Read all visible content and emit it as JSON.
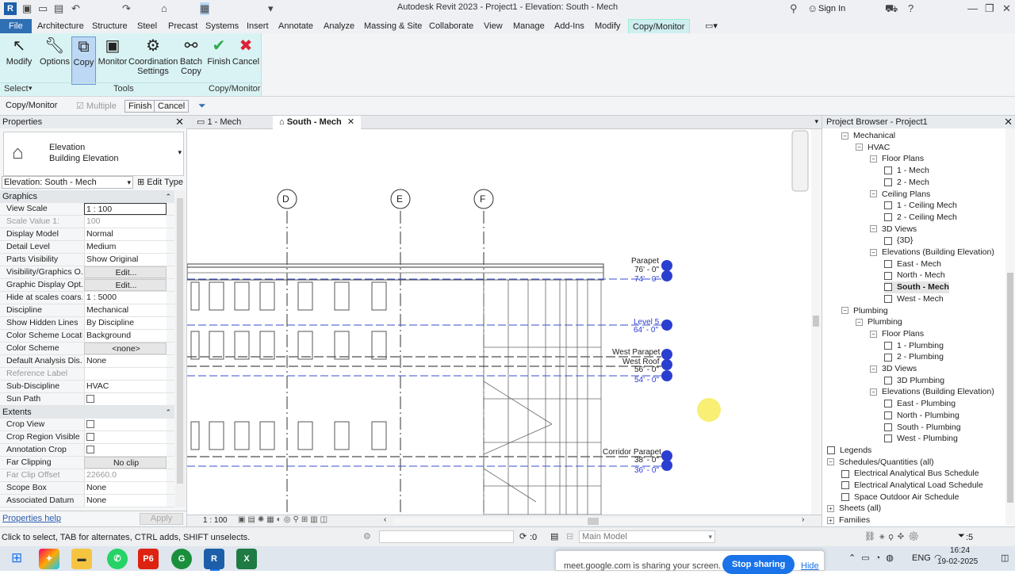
{
  "window": {
    "title": "Autodesk Revit 2023 - Project1 - Elevation: South - Mech",
    "sign_in": "Sign In"
  },
  "menu": [
    "File",
    "Architecture",
    "Structure",
    "Steel",
    "Precast",
    "Systems",
    "Insert",
    "Annotate",
    "Analyze",
    "Massing & Site",
    "Collaborate",
    "View",
    "Manage",
    "Add-Ins",
    "Modify",
    "Copy/Monitor"
  ],
  "ribbon": {
    "buttons": [
      {
        "label": "Modify",
        "icon": "cursor-icon"
      },
      {
        "label": "Options",
        "icon": "wrench-icon"
      },
      {
        "label": "Copy",
        "icon": "copy-icon"
      },
      {
        "label": "Monitor",
        "icon": "monitor-icon"
      },
      {
        "label": "Coordination Settings",
        "icon": "settings-icon"
      },
      {
        "label": "Batch Copy",
        "icon": "batch-icon"
      },
      {
        "label": "Finish",
        "icon": "check-icon"
      },
      {
        "label": "Cancel",
        "icon": "x-icon"
      }
    ],
    "panel_select": "Select",
    "panel_tools": "Tools",
    "panel_copymon": "Copy/Monitor"
  },
  "optionsbar": {
    "context": "Copy/Monitor",
    "multiple": "Multiple",
    "finish": "Finish",
    "cancel": "Cancel"
  },
  "properties": {
    "title": "Properties",
    "type_name": "Elevation",
    "type_sub": "Building Elevation",
    "selector": "Elevation: South - Mech",
    "edit_type": "Edit Type",
    "graphics": "Graphics",
    "rows": [
      {
        "k": "View Scale",
        "v": "1 : 100"
      },
      {
        "k": "Scale Value    1:",
        "v": "100",
        "dim": true
      },
      {
        "k": "Display Model",
        "v": "Normal"
      },
      {
        "k": "Detail Level",
        "v": "Medium"
      },
      {
        "k": "Parts Visibility",
        "v": "Show Original"
      },
      {
        "k": "Visibility/Graphics O...",
        "v": "Edit...",
        "btn": true
      },
      {
        "k": "Graphic Display Opt...",
        "v": "Edit...",
        "btn": true
      },
      {
        "k": "Hide at scales coars...",
        "v": "1 : 5000"
      },
      {
        "k": "Discipline",
        "v": "Mechanical"
      },
      {
        "k": "Show Hidden Lines",
        "v": "By Discipline"
      },
      {
        "k": "Color Scheme Locati...",
        "v": "Background"
      },
      {
        "k": "Color Scheme",
        "v": "<none>",
        "btn": true
      },
      {
        "k": "Default Analysis Dis...",
        "v": "None"
      },
      {
        "k": "Reference Label",
        "v": "",
        "dim": true
      },
      {
        "k": "Sub-Discipline",
        "v": "HVAC"
      },
      {
        "k": "Sun Path",
        "v": "",
        "cb": true
      }
    ],
    "extents": "Extents",
    "rows2": [
      {
        "k": "Crop View",
        "v": "",
        "cb": true
      },
      {
        "k": "Crop Region Visible",
        "v": "",
        "cb": true
      },
      {
        "k": "Annotation Crop",
        "v": "",
        "cb": true
      },
      {
        "k": "Far Clipping",
        "v": "No clip",
        "btn": true
      },
      {
        "k": "Far Clip Offset",
        "v": "22660.0",
        "dim": true
      },
      {
        "k": "Scope Box",
        "v": "None"
      },
      {
        "k": "Associated Datum",
        "v": "None"
      }
    ],
    "help": "Properties help",
    "apply": "Apply"
  },
  "tabs": [
    {
      "label": "1 - Mech"
    },
    {
      "label": "South - Mech"
    }
  ],
  "drawing": {
    "grids": [
      "D",
      "E",
      "F"
    ],
    "levels": [
      {
        "name": "Parapet",
        "elev": "76' - 0\""
      },
      {
        "name": "",
        "elev": "74' - 0\""
      },
      {
        "name": "Level 5",
        "elev": "64' - 0\""
      },
      {
        "name": "West Parapet",
        "elev": ""
      },
      {
        "name": "West Roof",
        "elev": "56' - 0\""
      },
      {
        "name": "",
        "elev": "54' - 0\""
      },
      {
        "name": "Corridor Parapet",
        "elev": "38' - 0\""
      },
      {
        "name": "",
        "elev": "36' - 0\""
      }
    ]
  },
  "viewbar": {
    "scale": "1 : 100"
  },
  "browser": {
    "title": "Project Browser - Project1"
  },
  "tree": [
    {
      "t": "Mechanical",
      "d": 1,
      "g": "−"
    },
    {
      "t": "HVAC",
      "d": 2,
      "g": "−"
    },
    {
      "t": "Floor Plans",
      "d": 3,
      "g": "−"
    },
    {
      "t": "1 - Mech",
      "d": 4,
      "v": true
    },
    {
      "t": "2 - Mech",
      "d": 4,
      "v": true
    },
    {
      "t": "Ceiling Plans",
      "d": 3,
      "g": "−"
    },
    {
      "t": "1 - Ceiling Mech",
      "d": 4,
      "v": true
    },
    {
      "t": "2 - Ceiling Mech",
      "d": 4,
      "v": true
    },
    {
      "t": "3D Views",
      "d": 3,
      "g": "−"
    },
    {
      "t": "{3D}",
      "d": 4,
      "v": true
    },
    {
      "t": "Elevations (Building Elevation)",
      "d": 3,
      "g": "−"
    },
    {
      "t": "East - Mech",
      "d": 4,
      "v": true
    },
    {
      "t": "North - Mech",
      "d": 4,
      "v": true
    },
    {
      "t": "South - Mech",
      "d": 4,
      "v": true,
      "sel": true
    },
    {
      "t": "West - Mech",
      "d": 4,
      "v": true
    },
    {
      "t": "Plumbing",
      "d": 1,
      "g": "−"
    },
    {
      "t": "Plumbing",
      "d": 2,
      "g": "−"
    },
    {
      "t": "Floor Plans",
      "d": 3,
      "g": "−"
    },
    {
      "t": "1 - Plumbing",
      "d": 4,
      "v": true
    },
    {
      "t": "2 - Plumbing",
      "d": 4,
      "v": true
    },
    {
      "t": "3D Views",
      "d": 3,
      "g": "−"
    },
    {
      "t": "3D Plumbing",
      "d": 4,
      "v": true
    },
    {
      "t": "Elevations (Building Elevation)",
      "d": 3,
      "g": "−"
    },
    {
      "t": "East - Plumbing",
      "d": 4,
      "v": true
    },
    {
      "t": "North - Plumbing",
      "d": 4,
      "v": true
    },
    {
      "t": "South - Plumbing",
      "d": 4,
      "v": true
    },
    {
      "t": "West - Plumbing",
      "d": 4,
      "v": true
    },
    {
      "t": "Legends",
      "d": 0,
      "v": true
    },
    {
      "t": "Schedules/Quantities (all)",
      "d": 0,
      "g": "−"
    },
    {
      "t": "Electrical Analytical Bus Schedule",
      "d": 1,
      "v": true
    },
    {
      "t": "Electrical Analytical Load Schedule",
      "d": 1,
      "v": true
    },
    {
      "t": "Space Outdoor Air Schedule",
      "d": 1,
      "v": true
    },
    {
      "t": "Sheets (all)",
      "d": 0,
      "g": "+"
    },
    {
      "t": "Families",
      "d": 0,
      "g": "+"
    }
  ],
  "status": {
    "hint": "Click to select, TAB for alternates, CTRL adds, SHIFT unselects.",
    "zero": ":0",
    "model": "Main Model",
    "filter_count": ":5"
  },
  "taskbar": {
    "share_text": "meet.google.com is sharing your screen.",
    "stop": "Stop sharing",
    "hide": "Hide",
    "lang": "ENG",
    "time": "16:24",
    "date": "19-02-2025"
  }
}
